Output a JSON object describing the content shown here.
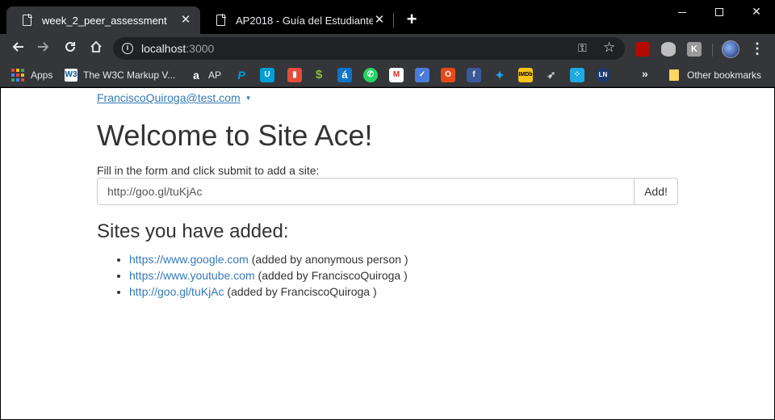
{
  "browser": {
    "tabs": [
      {
        "title": "week_2_peer_assessment",
        "active": true
      },
      {
        "title": "AP2018 - Guía del Estudiante",
        "active": false
      }
    ],
    "close_glyph": "✕",
    "new_tab_glyph": "+",
    "omnibox": {
      "host": "localhost",
      "port": ":3000"
    },
    "extensions": [
      "pdf-icon",
      "database-icon",
      "k-icon"
    ],
    "bookmarks": [
      {
        "label": "Apps",
        "icon": "apps-grid-icon"
      },
      {
        "label": "The W3C Markup V...",
        "icon": "w3c-icon"
      },
      {
        "label": "AP",
        "icon": "amazon-icon"
      },
      {
        "label": "",
        "icon": "paypal-icon"
      },
      {
        "label": "",
        "icon": "u-icon"
      },
      {
        "label": "",
        "icon": "trello-icon"
      },
      {
        "label": "",
        "icon": "dollar-icon"
      },
      {
        "label": "",
        "icon": "a-icon"
      },
      {
        "label": "",
        "icon": "whatsapp-icon"
      },
      {
        "label": "",
        "icon": "gmail-icon"
      },
      {
        "label": "",
        "icon": "tasks-icon"
      },
      {
        "label": "",
        "icon": "office-icon"
      },
      {
        "label": "",
        "icon": "facebook-icon"
      },
      {
        "label": "",
        "icon": "twitter-icon"
      },
      {
        "label": "",
        "icon": "imdb-icon"
      },
      {
        "label": "",
        "icon": "bird-icon"
      },
      {
        "label": "",
        "icon": "dots-icon"
      },
      {
        "label": "",
        "icon": "ln-icon"
      }
    ],
    "bookmarks_overflow": "»",
    "other_bookmarks": "Other bookmarks"
  },
  "page": {
    "user": "FranciscoQuiroga@test.com",
    "caret": "▼",
    "title": "Welcome to Site Ace!",
    "form_label": "Fill in the form and click submit to add a site:",
    "url_input_value": "http://goo.gl/tuKjAc",
    "add_button": "Add!",
    "section_title": "Sites you have added:",
    "sites": [
      {
        "url": "https://www.google.com",
        "added_by": "(added by anonymous person )"
      },
      {
        "url": "https://www.youtube.com",
        "added_by": "(added by FranciscoQuiroga )"
      },
      {
        "url": "http://goo.gl/tuKjAc",
        "added_by": "(added by FranciscoQuiroga )"
      }
    ]
  },
  "colors": {
    "link": "#337ab7",
    "text": "#333333",
    "browser_dark": "#35363a"
  }
}
